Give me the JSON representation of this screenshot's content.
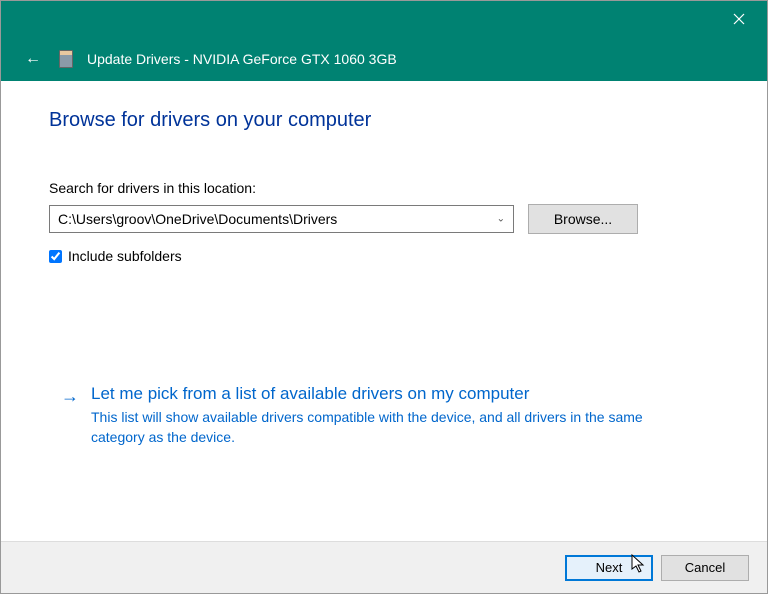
{
  "header": {
    "title": "Update Drivers - NVIDIA GeForce GTX 1060 3GB"
  },
  "main": {
    "heading": "Browse for drivers on your computer",
    "search_label": "Search for drivers in this location:",
    "path_value": "C:\\Users\\groov\\OneDrive\\Documents\\Drivers",
    "browse_label": "Browse...",
    "include_subfolders_label": "Include subfolders",
    "include_subfolders_checked": true
  },
  "pick_link": {
    "title": "Let me pick from a list of available drivers on my computer",
    "description": "This list will show available drivers compatible with the device, and all drivers in the same category as the device."
  },
  "footer": {
    "next_label": "Next",
    "cancel_label": "Cancel"
  }
}
